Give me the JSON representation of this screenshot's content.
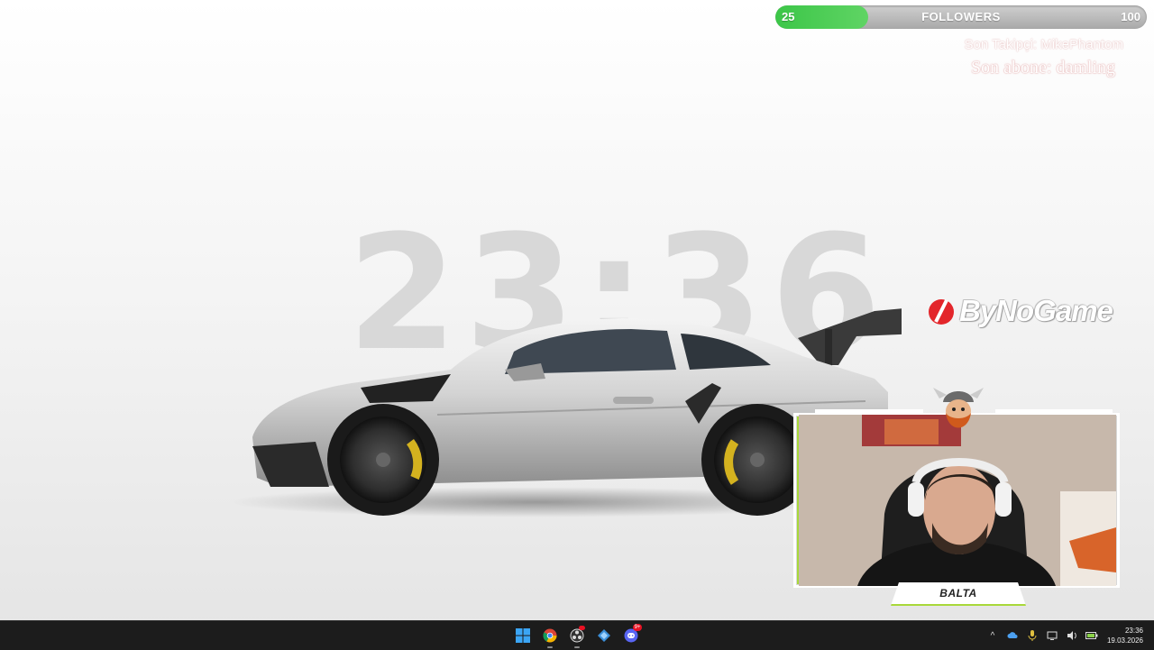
{
  "wallpaper": {
    "clock": "23:36",
    "brand": "ByNoGame",
    "brand_color": "#e3262b"
  },
  "overlay": {
    "followers": {
      "current": "25",
      "label": "FOLLOWERS",
      "goal": "100",
      "progress": 0.25,
      "fill_color": "#3cc648"
    },
    "last_follower": "Son Takipçi: MikePhantom",
    "last_subscriber": "Son abone: damling",
    "webcam": {
      "streamer_name": "BALTA",
      "accent_color": "#a8d83a"
    }
  },
  "taskbar": {
    "apps": [
      {
        "name": "windows-start-icon"
      },
      {
        "name": "chrome-icon",
        "active": true
      },
      {
        "name": "obs-icon",
        "active": true
      },
      {
        "name": "app-icon"
      },
      {
        "name": "discord-icon",
        "badge": "9+"
      }
    ],
    "tray": {
      "chevron": "^",
      "icons": [
        "network-cloud-icon",
        "microphone-icon",
        "display-network-icon",
        "volume-icon",
        "battery-icon"
      ]
    },
    "time": "23:36",
    "date": "19.03.2026"
  }
}
